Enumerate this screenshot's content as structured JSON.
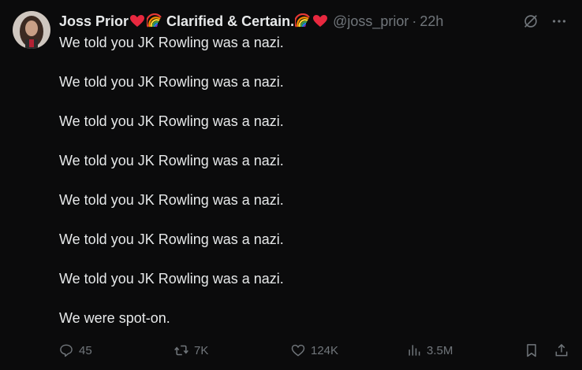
{
  "author": {
    "display_name": "Joss Prior",
    "name_suffix": "Clarified & Certain.",
    "handle": "@joss_prior",
    "separator": "·",
    "time": "22h"
  },
  "icons": {
    "avatar": "profile-photo",
    "emoji_heart": "red-heart",
    "emoji_rainbow": "rainbow",
    "grok": "grok-icon",
    "more": "more-icon",
    "reply": "reply-icon",
    "repost": "repost-icon",
    "like": "heart-icon",
    "views": "views-icon",
    "bookmark": "bookmark-icon",
    "share": "share-icon"
  },
  "tweet": {
    "lines": [
      "We told you JK Rowling was a nazi.",
      "We told you JK Rowling was a nazi.",
      "We told you JK Rowling was a nazi.",
      "We told you JK Rowling was a nazi.",
      "We told you JK Rowling was a nazi.",
      "We told you JK Rowling was a nazi.",
      "We told you JK Rowling was a nazi.",
      "We were spot-on."
    ]
  },
  "stats": {
    "replies": "45",
    "reposts": "7K",
    "likes": "124K",
    "views": "3.5M"
  },
  "colors": {
    "background": "#0b0b0c",
    "text": "#e7e9ea",
    "muted": "#71767b",
    "heart_red": "#e8283f"
  }
}
